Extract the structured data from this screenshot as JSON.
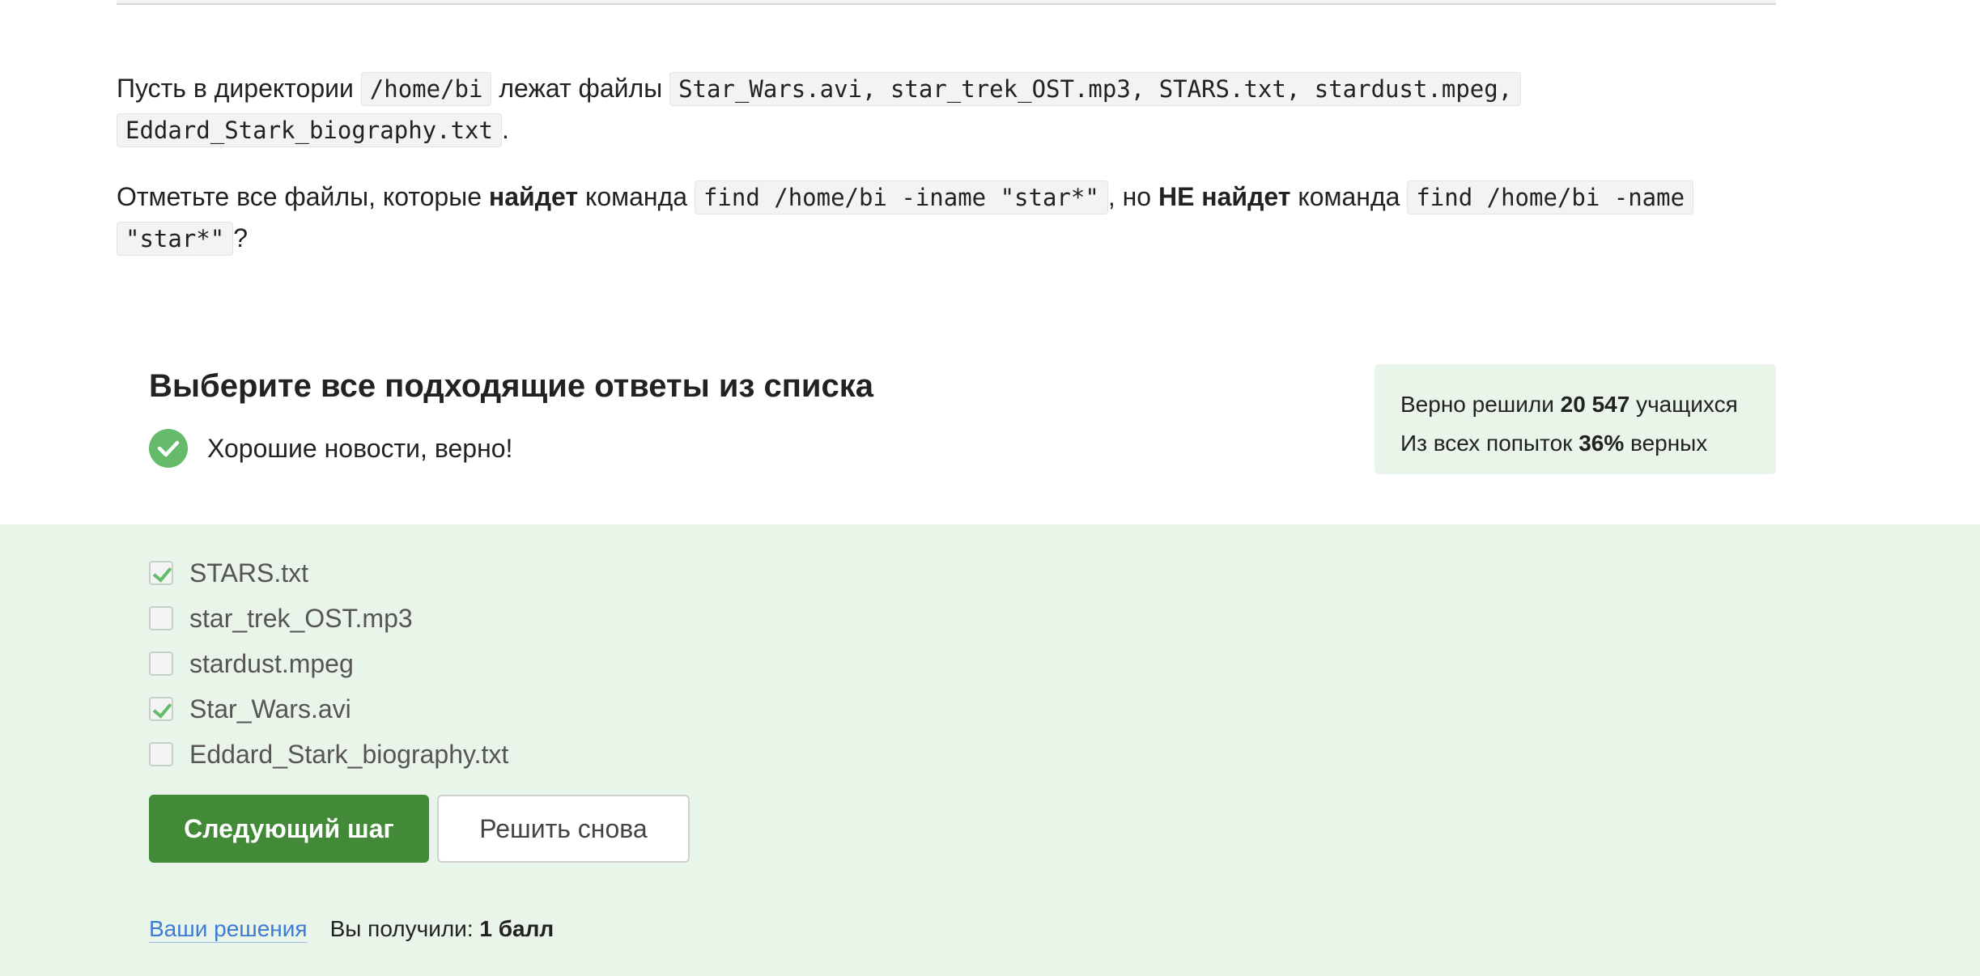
{
  "prompt": {
    "line1_prefix": "Пусть в директории",
    "dir_path": "/home/bi",
    "line1_mid": "лежат файлы",
    "files_list_a": "Star_Wars.avi, star_trek_OST.mp3, STARS.txt, stardust.mpeg,",
    "files_list_b": "Eddard_Stark_biography.txt",
    "line1_end": ".",
    "q_prefix": "Отметьте все файлы, которые",
    "q_bold1": "найдет",
    "q_mid1": "команда",
    "cmd_iname": "find /home/bi -iname \"star*\"",
    "q_mid2": ", но",
    "q_bold2": "НЕ найдет",
    "q_mid3": "команда",
    "cmd_name_a": "find /home/bi -name",
    "cmd_name_b": "\"star*\"",
    "q_end": "?"
  },
  "quiz": {
    "title": "Выберите все подходящие ответы из списка",
    "feedback": "Хорошие новости, верно!",
    "feedback_icon": "check-circle-icon",
    "accent_color": "#66bb6a"
  },
  "stats": {
    "solved_prefix": "Верно решили",
    "solved_count": "20 547",
    "solved_suffix": "учащихся",
    "attempts_prefix": "Из всех попыток",
    "attempts_percent": "36%",
    "attempts_suffix": "верных"
  },
  "options": [
    {
      "label": "STARS.txt",
      "checked": true
    },
    {
      "label": "star_trek_OST.mp3",
      "checked": false
    },
    {
      "label": "stardust.mpeg",
      "checked": false
    },
    {
      "label": "Star_Wars.avi",
      "checked": true
    },
    {
      "label": "Eddard_Stark_biography.txt",
      "checked": false
    }
  ],
  "buttons": {
    "next": "Следующий шаг",
    "retry": "Решить снова",
    "primary_color": "#438a38"
  },
  "footer": {
    "solutions_link": "Ваши решения",
    "score_prefix": "Вы получили:",
    "score_value": "1 балл"
  }
}
